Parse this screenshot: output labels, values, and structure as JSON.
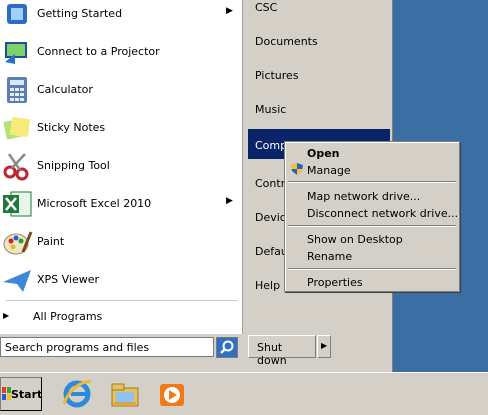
{
  "start_menu": {
    "programs": [
      {
        "label": "Getting Started",
        "icon": "getting-started-icon",
        "has_submenu": true
      },
      {
        "label": "Connect to a Projector",
        "icon": "projector-icon",
        "has_submenu": false
      },
      {
        "label": "Calculator",
        "icon": "calculator-icon",
        "has_submenu": false
      },
      {
        "label": "Sticky Notes",
        "icon": "sticky-notes-icon",
        "has_submenu": false
      },
      {
        "label": "Snipping Tool",
        "icon": "snipping-tool-icon",
        "has_submenu": false
      },
      {
        "label": "Microsoft Excel 2010",
        "icon": "excel-icon",
        "has_submenu": true
      },
      {
        "label": "Paint",
        "icon": "paint-icon",
        "has_submenu": false
      },
      {
        "label": "XPS Viewer",
        "icon": "xps-viewer-icon",
        "has_submenu": false
      }
    ],
    "submenu_arrow": "▶",
    "all_programs": "All Programs",
    "search_placeholder": "Search programs and files",
    "right_items": [
      "CSC",
      "Documents",
      "Pictures",
      "Music",
      "Compu",
      "Contro",
      "Device",
      "Defau",
      "Help a"
    ],
    "shutdown_label": "Shut down"
  },
  "context_menu": {
    "items": [
      {
        "label": "Open",
        "bold": true
      },
      {
        "label": "Manage",
        "icon": "uac-shield-icon"
      },
      {
        "label": "Map network drive..."
      },
      {
        "label": "Disconnect network drive..."
      },
      {
        "label": "Show on Desktop"
      },
      {
        "label": "Rename"
      },
      {
        "label": "Properties"
      }
    ]
  },
  "taskbar": {
    "start_label": "Start",
    "pinned": [
      "internet-explorer-icon",
      "windows-explorer-icon",
      "media-player-icon"
    ]
  },
  "colors": {
    "desktop": "#3a6ea5",
    "selection": "#0a246a",
    "menu_face": "#d4d0c8"
  }
}
